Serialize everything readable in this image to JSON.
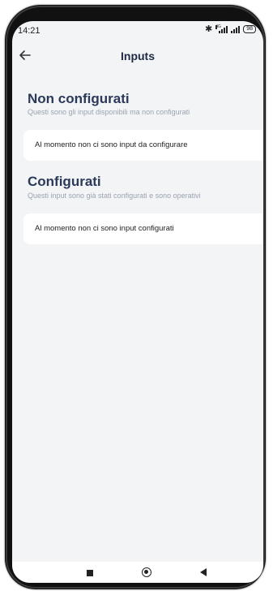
{
  "status_bar": {
    "time": "14:21",
    "signal_tag": "4G",
    "battery": "98"
  },
  "header": {
    "title": "Inputs",
    "back_icon": "arrow-left-icon"
  },
  "sections": [
    {
      "title": "Non configurati",
      "subtitle": "Questi sono gli input disponibili ma non configurati",
      "card_text": "Al momento non ci sono input da configurare"
    },
    {
      "title": "Configurati",
      "subtitle": "Questi input sono già stati configurati e sono operativi",
      "card_text": "Al momento non ci sono input configurati"
    }
  ],
  "nav_bar": {
    "recents_icon": "square-icon",
    "home_icon": "circle-icon",
    "back_icon": "triangle-back-icon"
  },
  "colors": {
    "background": "#f3f4f6",
    "card": "#ffffff",
    "title": "#2b3a5a",
    "subtitle": "#9aa3b2"
  }
}
